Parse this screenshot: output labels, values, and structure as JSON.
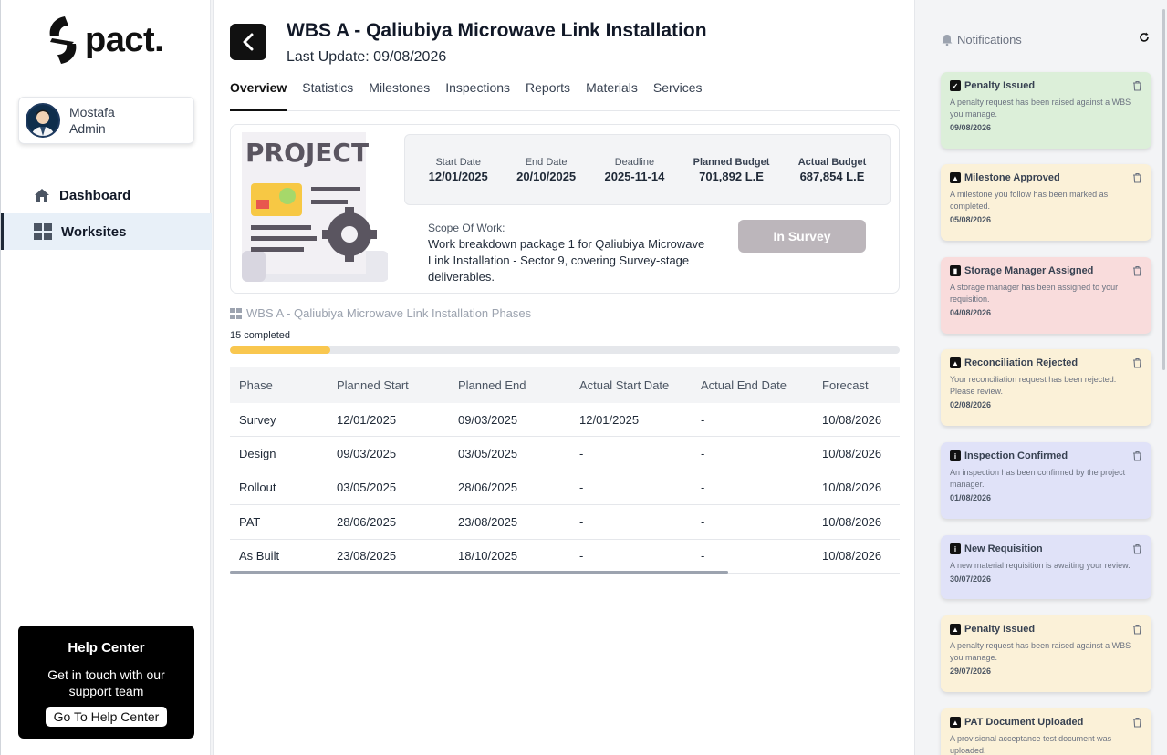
{
  "brand": {
    "logo_text": "pact."
  },
  "user": {
    "name": "Mostafa",
    "role": "Admin"
  },
  "nav": {
    "items": [
      {
        "label": "Dashboard"
      },
      {
        "label": "Worksites"
      }
    ]
  },
  "help": {
    "title": "Help Center",
    "text": "Get in touch with our support team",
    "button": "Go To Help Center"
  },
  "header": {
    "title": "WBS A - Qaliubiya Microwave Link Installation",
    "last_update": "Last Update: 09/08/2026"
  },
  "tabs": [
    "Overview",
    "Statistics",
    "Milestones",
    "Inspections",
    "Reports",
    "Materials",
    "Services"
  ],
  "project": {
    "image_text": "PROJECT",
    "dates": [
      {
        "label": "Start Date",
        "value": "12/01/2025"
      },
      {
        "label": "End Date",
        "value": "20/10/2025"
      },
      {
        "label": "Deadline",
        "value": "2025-11-14"
      },
      {
        "label": "Planned Budget",
        "value": "701,892 L.E"
      },
      {
        "label": "Actual Budget",
        "value": "687,854 L.E"
      }
    ],
    "scope_label": "Scope Of Work:",
    "scope_text": "Work breakdown package 1 for Qaliubiya Microwave Link Installation - Sector 9, covering Survey-stage deliverables.",
    "status": "In Survey"
  },
  "phases": {
    "title": "WBS A - Qaliubiya Microwave Link Installation Phases",
    "completed_label": "15 completed",
    "progress_fraction": 0.15,
    "columns": [
      "Phase",
      "Planned Start",
      "Planned End",
      "Actual Start Date",
      "Actual End Date",
      "Forecast"
    ],
    "rows": [
      [
        "Survey",
        "12/01/2025",
        "09/03/2025",
        "12/01/2025",
        "-",
        "10/08/2026"
      ],
      [
        "Design",
        "09/03/2025",
        "03/05/2025",
        "-",
        "-",
        "10/08/2026"
      ],
      [
        "Rollout",
        "03/05/2025",
        "28/06/2025",
        "-",
        "-",
        "10/08/2026"
      ],
      [
        "PAT",
        "28/06/2025",
        "23/08/2025",
        "-",
        "-",
        "10/08/2026"
      ],
      [
        "As Built",
        "23/08/2025",
        "18/10/2025",
        "-",
        "-",
        "10/08/2026"
      ]
    ]
  },
  "notifications": {
    "header": "Notifications",
    "items": [
      {
        "title": "Penalty Issued",
        "body": "A penalty request has been raised against a WBS you manage.",
        "date": "09/08/2026",
        "color": "#dcefd9",
        "icon": "check-icon"
      },
      {
        "title": "Milestone Approved",
        "body": "A milestone you follow has been marked as completed.",
        "date": "05/08/2026",
        "color": "#fbf1d8",
        "icon": "warning-icon"
      },
      {
        "title": "Storage Manager Assigned",
        "body": "A storage manager has been assigned to your requisition.",
        "date": "04/08/2026",
        "color": "#f9dcdc",
        "icon": "chart-icon"
      },
      {
        "title": "Reconciliation Rejected",
        "body": "Your reconciliation request has been rejected. Please review.",
        "date": "02/08/2026",
        "color": "#fbf1d8",
        "icon": "warning-icon"
      },
      {
        "title": "Inspection Confirmed",
        "body": "An inspection has been confirmed by the project manager.",
        "date": "01/08/2026",
        "color": "#e0e2f8",
        "icon": "info-icon"
      },
      {
        "title": "New Requisition",
        "body": "A new material requisition is awaiting your review.",
        "date": "30/07/2026",
        "color": "#e0e2f8",
        "icon": "info-icon"
      },
      {
        "title": "Penalty Issued",
        "body": "A penalty request has been raised against a WBS you manage.",
        "date": "29/07/2026",
        "color": "#fbf1d8",
        "icon": "warning-icon"
      },
      {
        "title": "PAT Document Uploaded",
        "body": "A provisional acceptance test document was uploaded.",
        "date": "",
        "color": "#fbf1d8",
        "icon": "warning-icon"
      }
    ]
  }
}
